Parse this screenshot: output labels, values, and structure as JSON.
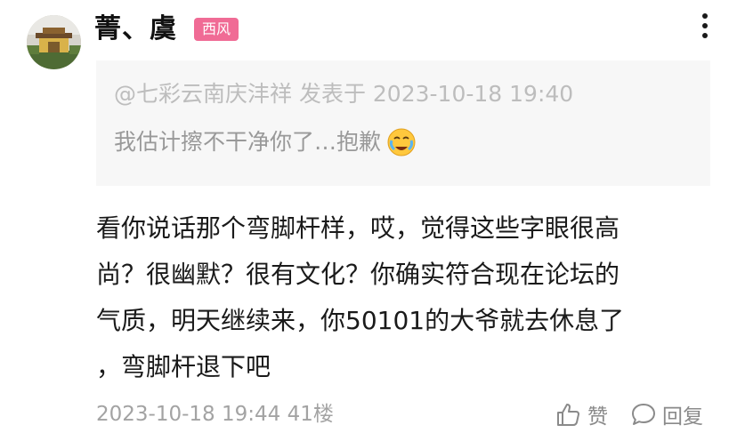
{
  "post": {
    "username": "菁、虞",
    "badge": "西风",
    "quote": {
      "meta": "@七彩云南庆沣祥 发表于 2023-10-18 19:40",
      "text": "我估计擦不干净你了…抱歉",
      "emoji": "crying-face-icon"
    },
    "body_lines": [
      "看你说话那个弯脚杆样，哎，觉得这些字眼很高",
      "尚？很幽默？很有文化？你确实符合现在论坛的",
      "气质，明天继续来，你50101的大爷就去休息了",
      "，弯脚杆退下吧"
    ],
    "footer": {
      "time_floor": "2023-10-18 19:44  41楼",
      "like_label": "赞",
      "reply_label": "回复"
    }
  },
  "colors": {
    "badge_bg": "#f06b95",
    "quote_bg": "#f7f7f7"
  },
  "icons": [
    "more-vertical-icon",
    "thumbs-up-icon",
    "comment-bubble-icon"
  ]
}
